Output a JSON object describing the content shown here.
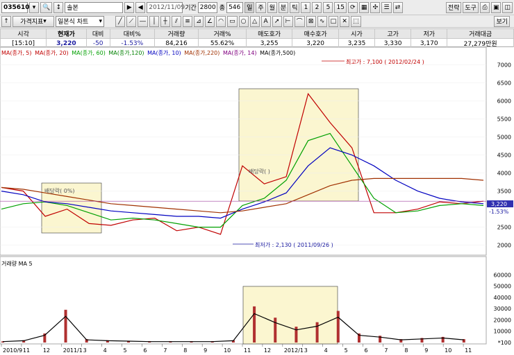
{
  "toolbar": {
    "code": "035610",
    "name": "솔본",
    "date": "2012/11/09",
    "period_label": "기간",
    "period": "2800",
    "count_label": "총",
    "count": "546",
    "period_btns": [
      "일",
      "주",
      "월",
      "분",
      "틱",
      "1",
      "2",
      "5",
      "15"
    ],
    "strategy_btn": "전략",
    "tools_btn": "도구",
    "view_btn": "보기",
    "indicator_btn": "가격지표",
    "chart_type": "일본식 차트"
  },
  "quote": {
    "headers": [
      "시각",
      "현재가",
      "대비",
      "대비%",
      "거래량",
      "거래%",
      "매도호가",
      "매수호가",
      "시가",
      "고가",
      "저가",
      "거래대금"
    ],
    "values": [
      "[15:10]",
      "3,220",
      "-50",
      "-1.53%",
      "84,216",
      "55.62%",
      "3,255",
      "3,220",
      "3,235",
      "3,330",
      "3,170",
      "27,279만원"
    ]
  },
  "legend": {
    "items": [
      "MA(종가, 5)",
      "MA(종가, 20)",
      "MA(종가, 60)",
      "MA(종가,120)",
      "MA(종가, 10)",
      "MA(종가,220)",
      "MA(종가, 14)",
      "MA(종가,500)"
    ],
    "colors": [
      "#c00000",
      "#c00000",
      "#00a000",
      "#008000",
      "#0000c0",
      "#a03000",
      "#800080",
      "#000000"
    ]
  },
  "volume_legend": "거래량 MA 5",
  "annotations": {
    "high": "최고가 : 7,100 ( 2012/02/24 )",
    "low": "최저가 : 2,130 ( 2011/09/26 )",
    "div1": "배당락( 0%)",
    "div2": "배당락( )",
    "price_tag": "3,220",
    "pct_tag": "-1.53%"
  },
  "axis": {
    "price_ticks": [
      "7000",
      "6500",
      "6000",
      "5500",
      "5000",
      "4500",
      "4000",
      "3500",
      "2500",
      "2000"
    ],
    "volume_ticks": [
      "60000",
      "50000",
      "40000",
      "30000",
      "20000",
      "10000",
      "*100"
    ],
    "x_ticks": [
      "2010/9",
      "11",
      "12",
      "2011/1",
      "3",
      "4",
      "5",
      "6",
      "7",
      "8",
      "9",
      "10",
      "11",
      "12",
      "2012/1",
      "3",
      "4",
      "5",
      "6",
      "7",
      "8",
      "9",
      "10",
      "11"
    ]
  },
  "chart_data": {
    "type": "line",
    "series": [
      {
        "name": "MA(종가, 5)",
        "values": [
          3600,
          3500,
          2800,
          3000,
          2600,
          2550,
          2700,
          2750,
          2400,
          2500,
          2300,
          4200,
          3700,
          3900,
          6200,
          5400,
          4700,
          2900,
          2900,
          3000,
          3200,
          3150,
          3220
        ]
      },
      {
        "name": "MA(종가, 60)",
        "values": [
          3000,
          3150,
          3200,
          3100,
          2900,
          2700,
          2750,
          2700,
          2600,
          2500,
          2500,
          3100,
          3300,
          3800,
          4900,
          5100,
          4200,
          3300,
          2900,
          2950,
          3100,
          3150,
          3100
        ]
      },
      {
        "name": "MA(종가,120)",
        "values": [
          3500,
          3400,
          3200,
          3150,
          3050,
          2950,
          2900,
          2850,
          2800,
          2800,
          2750,
          3000,
          3200,
          3450,
          4200,
          4700,
          4500,
          4200,
          3800,
          3500,
          3300,
          3200,
          3150
        ]
      },
      {
        "name": "MA(종가,220)",
        "values": [
          3600,
          3550,
          3450,
          3350,
          3250,
          3150,
          3100,
          3050,
          3000,
          2950,
          2900,
          2950,
          3050,
          3150,
          3400,
          3650,
          3800,
          3850,
          3850,
          3850,
          3850,
          3850,
          3800
        ]
      }
    ],
    "ylim": [
      1800,
      7300
    ],
    "high": 7100,
    "low": 2130,
    "current": 3220,
    "volume": {
      "ylim": [
        0,
        70000
      ],
      "peaks": [
        1000,
        2000,
        8000,
        29000,
        3000,
        2000,
        1500,
        1000,
        1000,
        1000,
        1000,
        2000,
        32000,
        22000,
        14000,
        18000,
        28000,
        8000,
        6000,
        3000,
        4000,
        5000,
        3000
      ]
    }
  }
}
